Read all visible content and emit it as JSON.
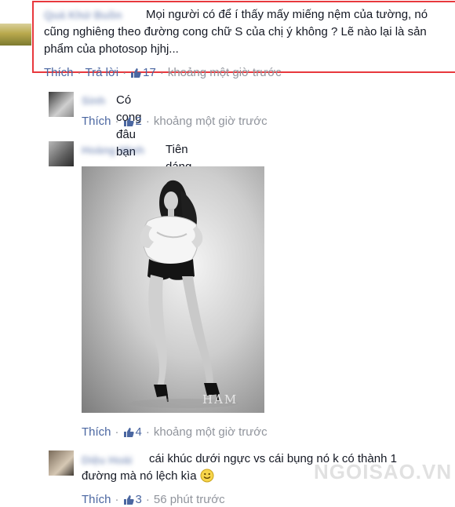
{
  "comments": [
    {
      "author": "Quá Khứ Buồn",
      "text": "Mọi người có để í thấy mấy miếng nệm của tường, nó cũng nghiêng theo đường cong chữ S của chị ý không ? Lẽ nào lại là sản phẩm của photosop hjhj...",
      "like_label": "Thích",
      "reply_label": "Trả lời",
      "like_count": "17",
      "time": "khoảng một giờ trước"
    },
    {
      "author": "Sinh",
      "text": "Có cong đâu bạn",
      "like_label": "Thích",
      "like_count": "2",
      "time": "khoảng một giờ trước"
    },
    {
      "author": "Hoàng Minh",
      "text": "Tiên dáng chuẩn bạn ui =))))",
      "like_label": "Thích",
      "like_count": "4",
      "time": "khoảng một giờ trước"
    },
    {
      "author": "Diệu Hoài",
      "text": "cái khúc dưới ngực vs cái bụng nó k có thành 1 đường mà nó lệch kìa",
      "like_label": "Thích",
      "like_count": "3",
      "time": "56 phút trước"
    }
  ],
  "photo_watermark": "HAM",
  "site_watermark": "NGOISAO.VN",
  "separator": "·",
  "colors": {
    "link": "#4b67a1",
    "meta": "#90949c",
    "highlight": "#e8383d"
  },
  "icons": [
    "thumbs-up-icon",
    "smiley-icon"
  ]
}
